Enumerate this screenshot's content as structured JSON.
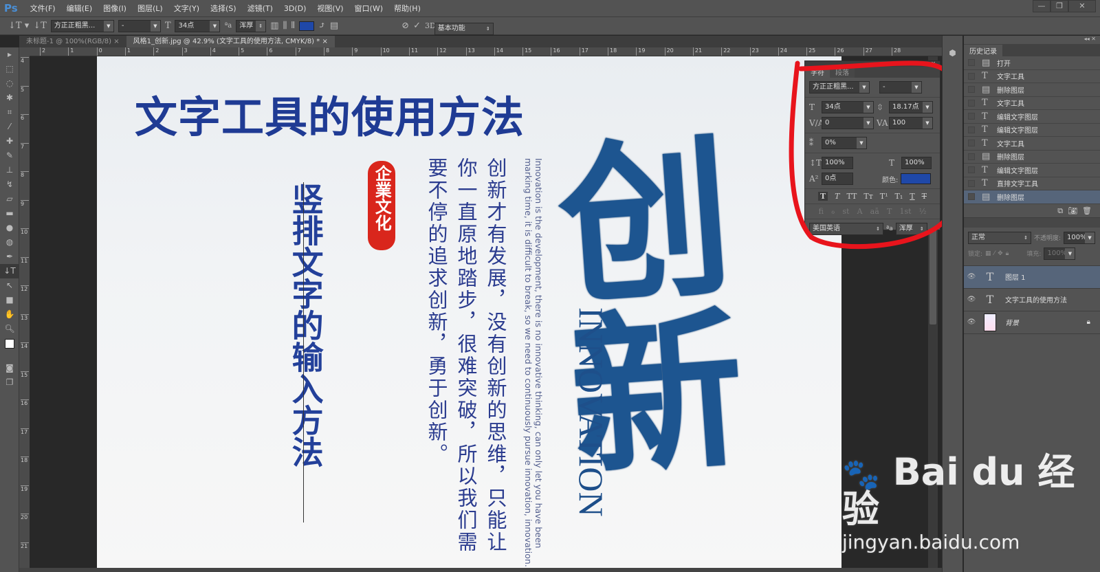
{
  "app": {
    "logo": "Ps",
    "workspace": "基本功能"
  },
  "menu": [
    "文件(F)",
    "编辑(E)",
    "图像(I)",
    "图层(L)",
    "文字(Y)",
    "选择(S)",
    "滤镜(T)",
    "3D(D)",
    "视图(V)",
    "窗口(W)",
    "帮助(H)"
  ],
  "window_controls": [
    "—",
    "❐",
    "✕"
  ],
  "options": {
    "font_family": "方正正粗黑...",
    "font_style": "-",
    "font_size": "34点",
    "aa_label": "ªa",
    "antialias": "浑厚",
    "color": "#1f48a8",
    "three_d": "3D"
  },
  "tabs": [
    {
      "label": "未标题-1 @ 100%(RGB/8)",
      "close": "×"
    },
    {
      "label": "风格1_创新.jpg @ 42.9% (文字工具的使用方法, CMYK/8) *",
      "close": "×"
    }
  ],
  "ruler_h": [
    "2",
    "1",
    "0",
    "1",
    "2",
    "3",
    "4",
    "5",
    "6",
    "7",
    "8",
    "9",
    "10",
    "11",
    "12",
    "13",
    "14",
    "15",
    "16",
    "17",
    "18",
    "19",
    "20",
    "21",
    "22",
    "23",
    "24",
    "25",
    "26",
    "27",
    "28"
  ],
  "ruler_v": [
    "4",
    "5",
    "6",
    "7",
    "8",
    "9",
    "10",
    "11",
    "12",
    "13",
    "14",
    "15",
    "16",
    "17",
    "18",
    "19",
    "20",
    "21"
  ],
  "poster": {
    "title": "文字工具的使用方法",
    "vertical_title": "竖排文字的输入方法",
    "seal": "企業文化",
    "body_lines": [
      "创新才有发展，没有创新的思维，只能让",
      "你一直原地踏步，很难突破，所以我们需",
      "要不停的追求创新，勇于创新。"
    ],
    "english_lines": [
      "Innovation is the development, there is no innovative thinking, can only let you have been",
      "marking time, it is difficult to break, so we need to continuously pursue innovation, innovation."
    ],
    "calligraphy": "创新",
    "innovation": "INNOVATION",
    "colors": {
      "title": "#1f3b94",
      "seal": "#d9261c",
      "calligraphy": "#1d5590"
    }
  },
  "character_panel": {
    "tabs": [
      "字符",
      "段落"
    ],
    "font_family": "方正正粗黑...",
    "font_style": "-",
    "size": "34点",
    "leading": "18.17点",
    "kerning": "0",
    "tracking": "100",
    "scale_tsume": "0%",
    "vertical_scale": "100%",
    "horizontal_scale": "100%",
    "baseline_shift": "0点",
    "color_label": "颜色:",
    "color": "#1f48a8",
    "styles": [
      "T",
      "T",
      "TT",
      "Tт",
      "T¹",
      "T₁",
      "T",
      "T"
    ],
    "opentype": [
      "fi",
      "ℴ",
      "st",
      "A",
      "aā",
      "T",
      "1st",
      "½"
    ],
    "language": "美国英语",
    "aa_label": "ªa",
    "antialias": "浑厚"
  },
  "history": {
    "title": "历史记录",
    "items": [
      {
        "icon": "doc",
        "label": "打开"
      },
      {
        "icon": "T",
        "label": "文字工具"
      },
      {
        "icon": "doc",
        "label": "删除图层"
      },
      {
        "icon": "T",
        "label": "文字工具"
      },
      {
        "icon": "T",
        "label": "编辑文字图层"
      },
      {
        "icon": "T",
        "label": "编辑文字图层"
      },
      {
        "icon": "T",
        "label": "文字工具"
      },
      {
        "icon": "doc",
        "label": "删除图层"
      },
      {
        "icon": "T",
        "label": "编辑文字图层"
      },
      {
        "icon": "T",
        "label": "直排文字工具"
      },
      {
        "icon": "doc",
        "label": "删除图层",
        "selected": true
      }
    ]
  },
  "layers": {
    "blend_mode": "正常",
    "opacity_label": "不透明度:",
    "opacity": "100%",
    "lock_label": "锁定:",
    "fill_label": "填充:",
    "fill": "100%",
    "items": [
      {
        "name": "图层 1",
        "type": "text",
        "selected": true
      },
      {
        "name": "文字工具的使用方法",
        "type": "text"
      },
      {
        "name": "背景",
        "type": "image",
        "locked": true
      }
    ]
  },
  "watermark": {
    "brand": "Bai du 经验",
    "url": "jingyan.baidu.com"
  },
  "annotation_color": "#e8141c"
}
